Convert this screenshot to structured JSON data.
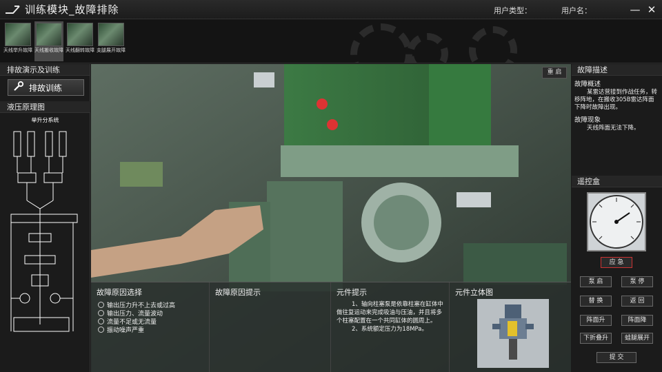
{
  "app": {
    "title": "训练模块_故障排除",
    "user_type_label": "用户类型：",
    "user_name_label": "用户名："
  },
  "window_controls": {
    "minimize": "—",
    "close": "✕"
  },
  "modules": [
    {
      "label": "天线举升故障",
      "active": false
    },
    {
      "label": "天线搬收故障",
      "active": true
    },
    {
      "label": "天线翻转故障",
      "active": false
    },
    {
      "label": "支腿展开故障",
      "active": false
    }
  ],
  "left": {
    "demo_title": "排故演示及训练",
    "train_button": "排故训练",
    "hydraulic_title": "液压原理图",
    "schematic_title": "举升分系统"
  },
  "viewport": {
    "reset_label": "重 启"
  },
  "cause_select": {
    "title": "故障原因选择",
    "options": [
      "输出压力升不上去或过高",
      "输出压力、流量波动",
      "流量不足或无流量",
      "振动噪声严重"
    ]
  },
  "cause_hint": {
    "title": "故障原因提示"
  },
  "component_hint": {
    "title": "元件提示",
    "text1": "1、轴向柱塞泵是依靠柱塞在缸体中做往复运动来完成吸油与压油，并且将多个柱塞配置在一个共同缸体的圆周上。",
    "text2": "2、系统额定压力为18MPa。"
  },
  "component_view": {
    "title": "元件立体图"
  },
  "fault": {
    "title": "故障描述",
    "overview_label": "故障概述",
    "overview_text": "某雷达营接到作战任务，转移阵地，在搬收305B雷达阵面下降时故障出现。",
    "phenomenon_label": "故障现象",
    "phenomenon_text": "天线阵面无法下降。"
  },
  "remote": {
    "title": "遥控盒",
    "emergency": "应 急",
    "buttons": [
      "泵 启",
      "泵 停",
      "替 换",
      "返 回",
      "阵面升",
      "阵面降",
      "下折叠升",
      "蛙腿展开"
    ],
    "submit": "提 交"
  },
  "colors": {
    "accent_red": "#cc3333",
    "panel_bg": "#1b1b1b",
    "machine_green": "#3f7a47"
  },
  "icons": {
    "logo": "logo-icon",
    "train": "wrench-icon"
  }
}
